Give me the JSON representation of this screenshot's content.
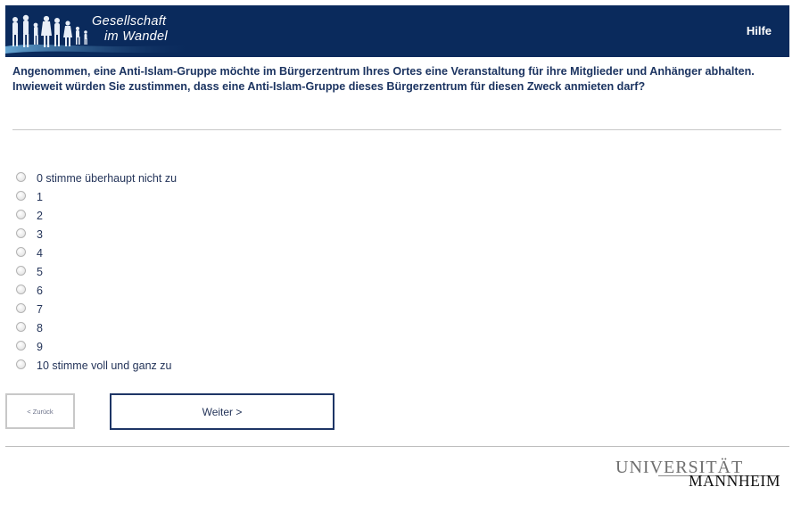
{
  "header": {
    "logo_line1": "Gesellschaft",
    "logo_line2": "im Wandel",
    "help_label": "Hilfe",
    "background_color": "#0a2a5c"
  },
  "question": {
    "text": "Angenommen, eine Anti-Islam-Gruppe möchte im Bürgerzentrum Ihres Ortes eine Veranstaltung für ihre Mitglieder und Anhänger abhalten. Inwieweit würden Sie zustimmen, dass eine Anti-Islam-Gruppe dieses Bürgerzentrum für diesen Zweck anmieten darf?"
  },
  "options": [
    "0 stimme überhaupt nicht zu",
    "1",
    "2",
    "3",
    "4",
    "5",
    "6",
    "7",
    "8",
    "9",
    "10 stimme voll und ganz zu"
  ],
  "navigation": {
    "back_label": "< Zurück",
    "next_label": "Weiter >"
  },
  "footer": {
    "university_line1": "UNIVERSITÄT",
    "university_line2": "MANNHEIM"
  }
}
